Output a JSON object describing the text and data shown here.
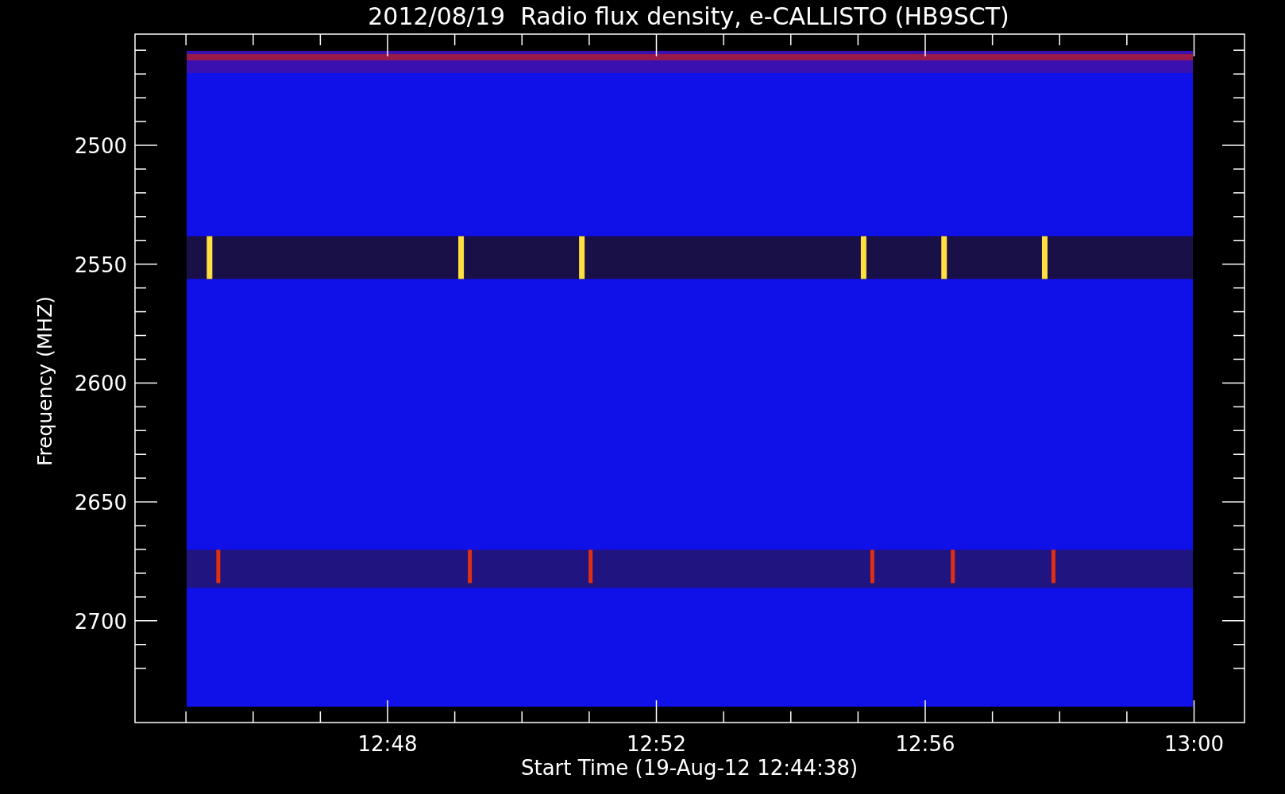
{
  "title": "2012/08/19  Radio flux density, e-CALLISTO (HB9SCT)",
  "y_axis": {
    "label": "Frequency (MHZ)",
    "ticks": [
      "2500",
      "2550",
      "2600",
      "2650",
      "2700"
    ]
  },
  "x_axis": {
    "label": "Start Time (19-Aug-12 12:44:38)",
    "ticks": [
      "12:48",
      "12:52",
      "12:56",
      "13:00"
    ]
  }
}
